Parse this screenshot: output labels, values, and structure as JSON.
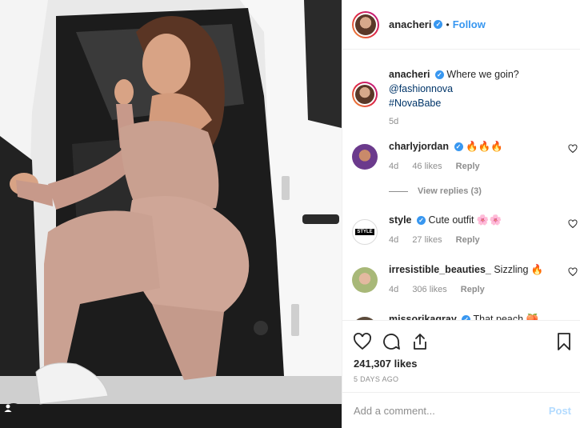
{
  "post": {
    "username": "anacheri",
    "follow_label": "Follow",
    "dot": "•",
    "caption": {
      "username": "anacheri",
      "text": "Where we goin?",
      "mention": "@fashionnova",
      "hashtag": "#NovaBabe",
      "time": "5d"
    },
    "comments": [
      {
        "username": "charlyjordan",
        "verified": true,
        "text": "🔥🔥🔥",
        "time": "4d",
        "likes": "46 likes",
        "reply": "Reply",
        "avatar_color": "#6b3a8c"
      },
      {
        "username": "style",
        "verified": true,
        "text": "Cute outfit 🌸🌸",
        "time": "4d",
        "likes": "27 likes",
        "reply": "Reply",
        "avatar_color": "#ffffff",
        "avatar_text": "STYLE"
      },
      {
        "username": "irresistible_beauties_",
        "verified": false,
        "text": "Sizzling 🔥",
        "time": "4d",
        "likes": "306 likes",
        "reply": "Reply",
        "avatar_color": "#a8b878"
      },
      {
        "username": "missorikagray",
        "verified": true,
        "text": "That peach 🍑",
        "avatar_color": "#5b4a3a"
      }
    ],
    "view_replies": "View replies (3)",
    "likes_count": "241,307 likes",
    "time_ago": "5 DAYS AGO",
    "comment_placeholder": "Add a comment...",
    "post_label": "Post",
    "verified_mark": "✓",
    "icons": {
      "like": "heart-icon",
      "comment": "comment-icon",
      "share": "share-icon",
      "save": "bookmark-icon"
    }
  }
}
